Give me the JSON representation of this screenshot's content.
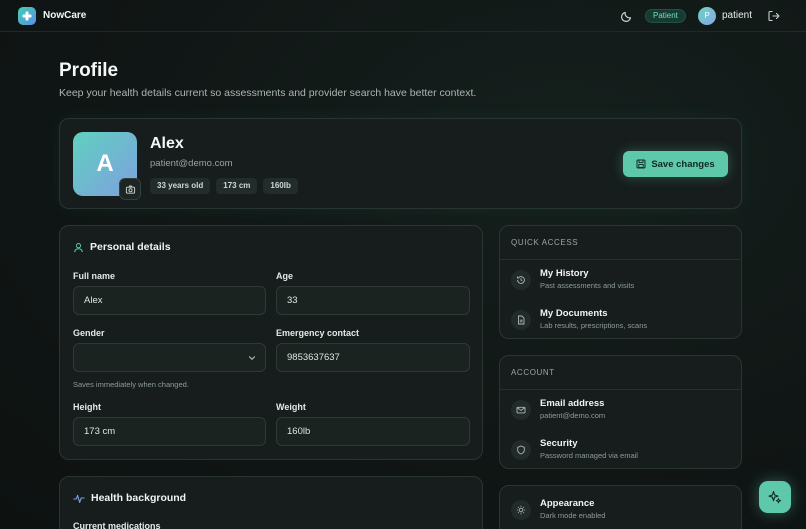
{
  "app": {
    "name": "NowCare"
  },
  "header": {
    "role_badge": "Patient",
    "avatar_initial": "P",
    "user_name": "patient"
  },
  "page": {
    "title": "Profile",
    "subtitle": "Keep your health details current so assessments and provider search have better context."
  },
  "profile": {
    "avatar_initial": "A",
    "name": "Alex",
    "email": "patient@demo.com",
    "chips": [
      "33 years old",
      "173 cm",
      "160lb"
    ],
    "save_label": "Save changes"
  },
  "personal": {
    "title": "Personal details",
    "full_name_label": "Full name",
    "full_name_value": "Alex",
    "age_label": "Age",
    "age_value": "33",
    "gender_label": "Gender",
    "gender_value": "",
    "emergency_label": "Emergency contact",
    "emergency_value": "9853637637",
    "hint": "Saves immediately when changed.",
    "height_label": "Height",
    "height_value": "173 cm",
    "weight_label": "Weight",
    "weight_value": "160lb"
  },
  "health": {
    "title": "Health background",
    "meds_label": "Current medications"
  },
  "quick_access": {
    "caption": "QUICK ACCESS",
    "items": [
      {
        "title": "My History",
        "sub": "Past assessments and visits",
        "icon": "history-icon"
      },
      {
        "title": "My Documents",
        "sub": "Lab results, prescriptions, scans",
        "icon": "document-icon"
      }
    ]
  },
  "account": {
    "caption": "ACCOUNT",
    "items": [
      {
        "title": "Email address",
        "sub": "patient@demo.com",
        "icon": "mail-icon"
      },
      {
        "title": "Security",
        "sub": "Password managed via email",
        "icon": "shield-icon"
      }
    ]
  },
  "appearance": {
    "title": "Appearance",
    "sub": "Dark mode enabled",
    "icon": "sun-icon"
  },
  "colors": {
    "accent": "#5ec9aa",
    "background": "#101615",
    "card": "#161d1c"
  }
}
